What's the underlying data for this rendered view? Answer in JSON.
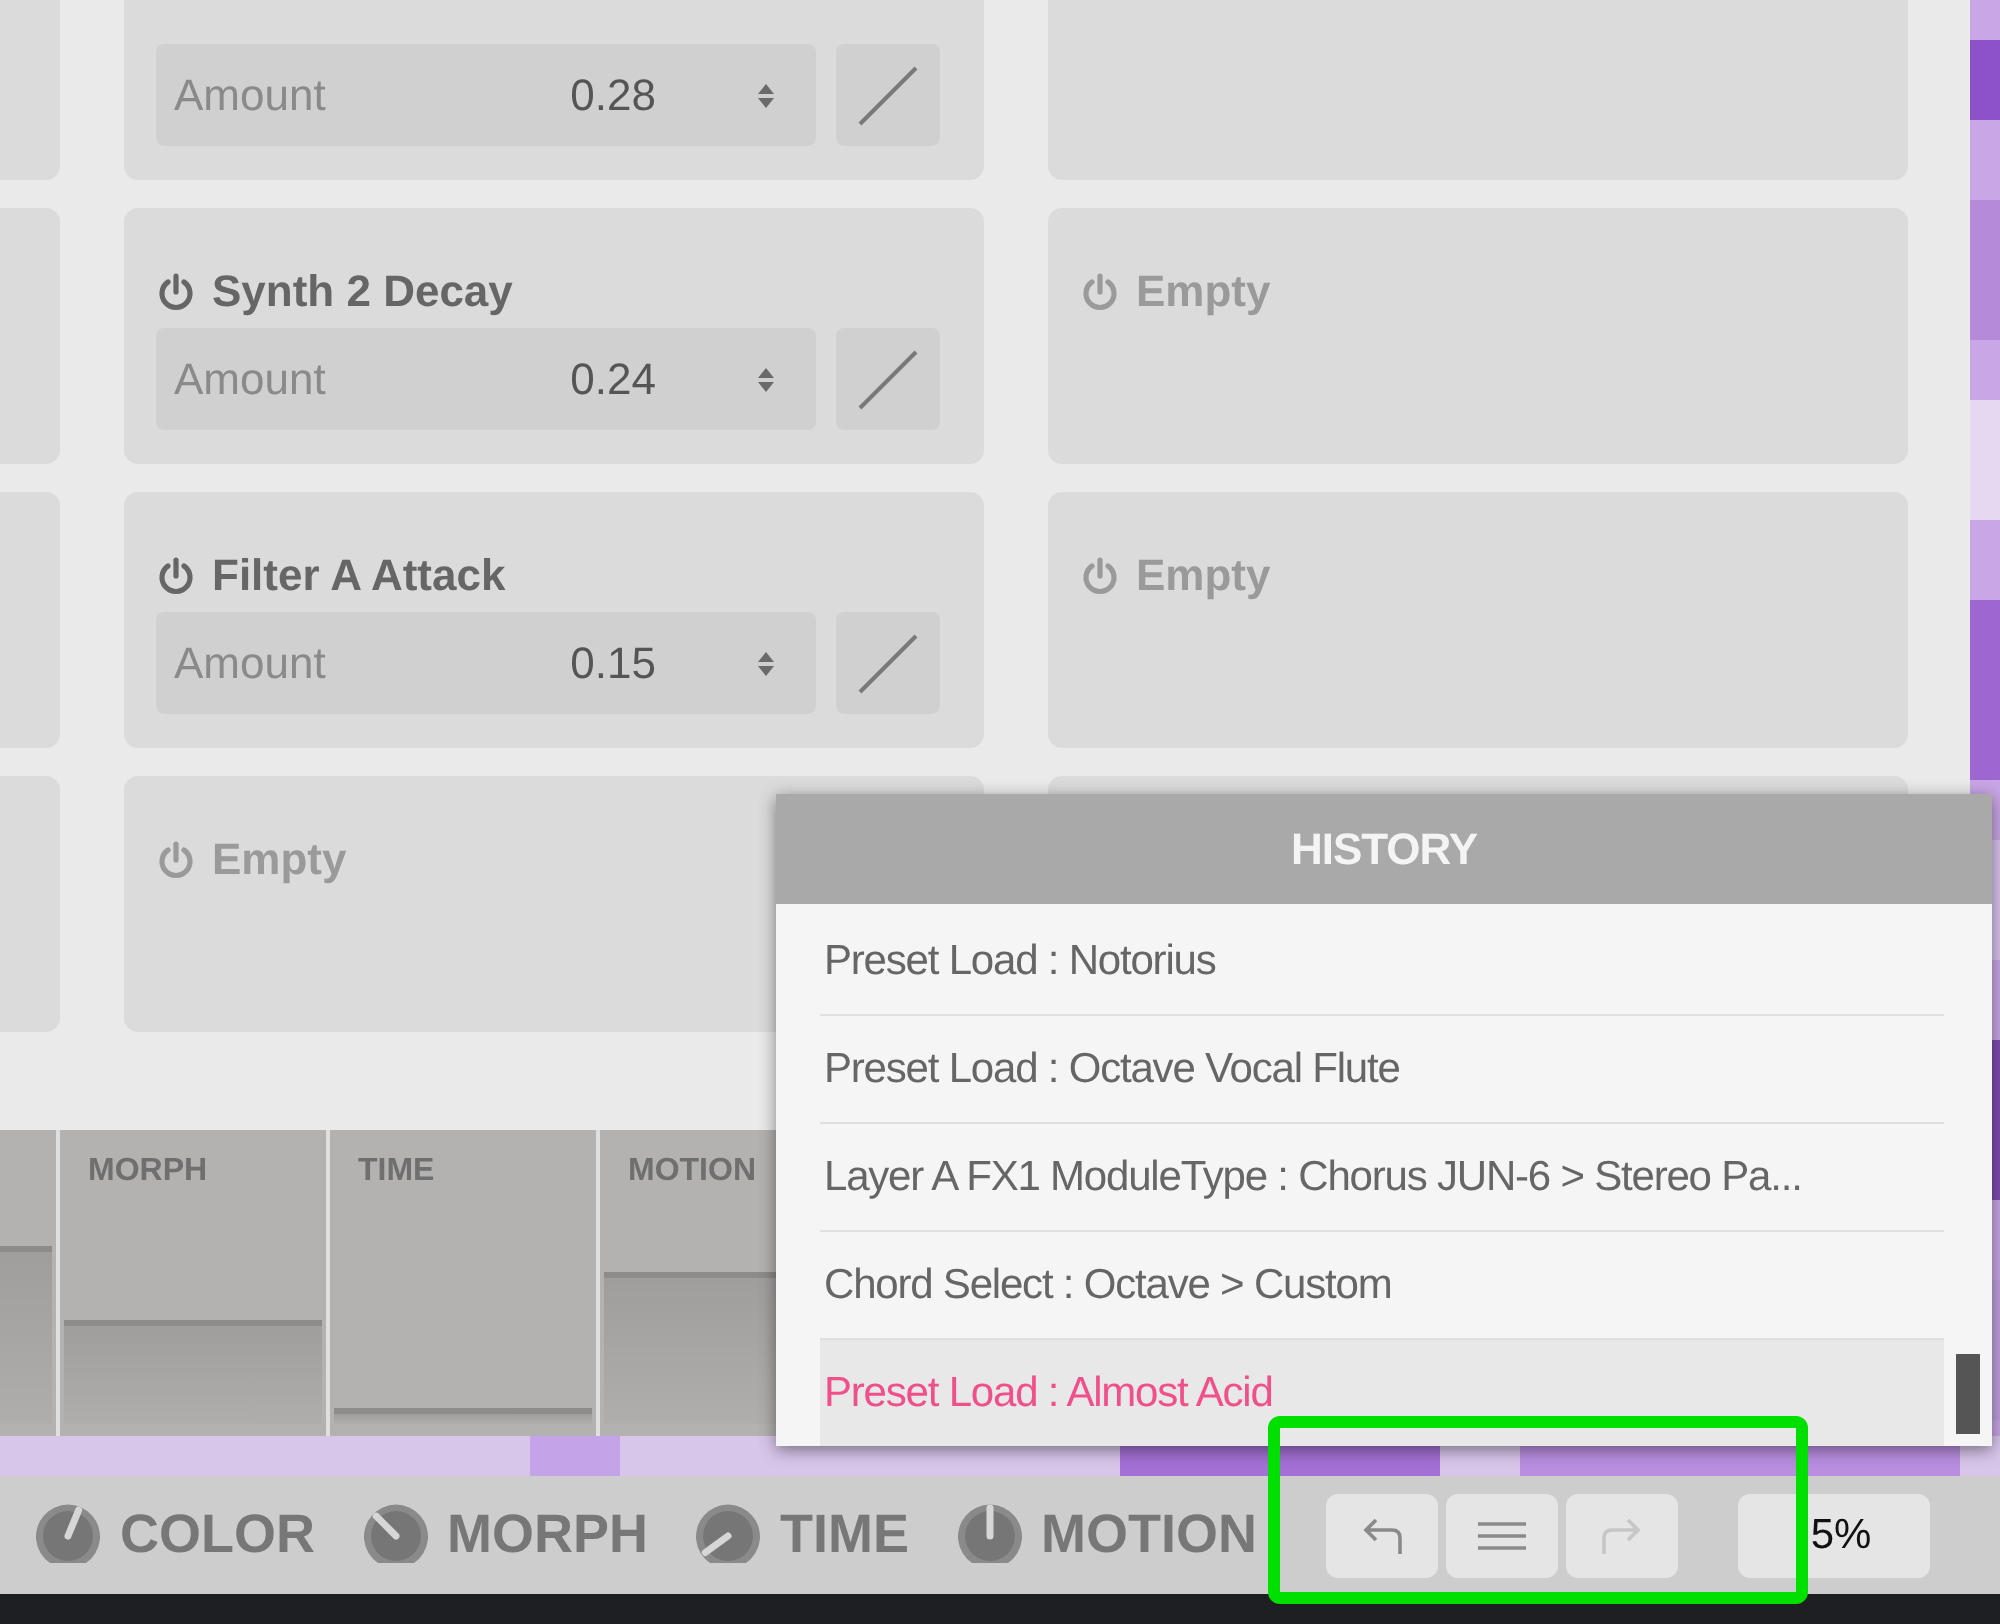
{
  "parameter_rows": [
    {
      "cards": [
        {
          "kind": "param",
          "field_label": "Amount",
          "value": "0.28"
        },
        {
          "kind": "empty"
        }
      ]
    },
    {
      "cards": [
        {
          "kind": "param",
          "title": "Synth 2 Decay",
          "field_label": "Amount",
          "value": "0.24"
        },
        {
          "kind": "empty",
          "title": "Empty"
        }
      ]
    },
    {
      "cards": [
        {
          "kind": "param",
          "title": "Filter A Attack",
          "field_label": "Amount",
          "value": "0.15"
        },
        {
          "kind": "empty",
          "title": "Empty"
        }
      ]
    },
    {
      "cards": [
        {
          "kind": "empty",
          "title": "Empty"
        },
        {
          "kind": "covered"
        }
      ]
    }
  ],
  "macro_columns": [
    {
      "level": 0.58
    },
    {
      "label": "MORPH",
      "level": 0.34
    },
    {
      "label": "TIME",
      "level": 0.05
    },
    {
      "label": "MOTION",
      "level": 0.5
    }
  ],
  "knobs": [
    {
      "label": "COLOR"
    },
    {
      "label": "MORPH"
    },
    {
      "label": "TIME"
    },
    {
      "label": "MOTION"
    }
  ],
  "toolbar": [
    {
      "kind": "undo",
      "disabled": false
    },
    {
      "kind": "menu",
      "disabled": false
    },
    {
      "kind": "redo",
      "disabled": true
    }
  ],
  "zoom_field": {
    "value": "5%"
  },
  "history": {
    "title": "HISTORY",
    "items": [
      {
        "text": "Preset Load : Notorius",
        "selected": false
      },
      {
        "text": "Preset Load : Octave Vocal Flute",
        "selected": false
      },
      {
        "text": "Layer A FX1 ModuleType : Chorus JUN-6 > Stereo Pa...",
        "selected": false
      },
      {
        "text": "Chord Select : Octave > Custom",
        "selected": false
      },
      {
        "text": "Preset Load : Almost Acid",
        "selected": true
      }
    ]
  }
}
